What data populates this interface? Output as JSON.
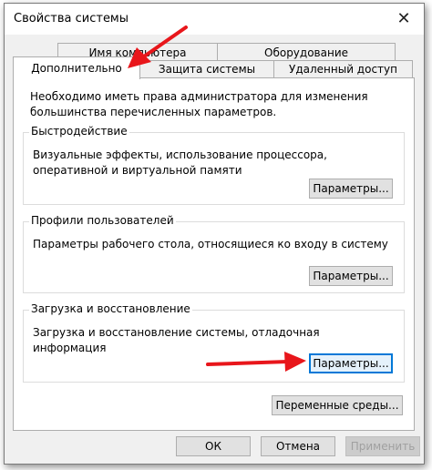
{
  "window": {
    "title": "Свойства системы",
    "close_glyph": "✕"
  },
  "tabs": {
    "computer_name": "Имя компьютера",
    "hardware": "Оборудование",
    "advanced": "Дополнительно",
    "system_protection": "Защита системы",
    "remote": "Удаленный доступ"
  },
  "panel": {
    "intro": "Необходимо иметь права администратора для изменения большинства перечисленных параметров.",
    "performance": {
      "title": "Быстродействие",
      "description": "Визуальные эффекты, использование процессора, оперативной и виртуальной памяти",
      "button": "Параметры..."
    },
    "user_profiles": {
      "title": "Профили пользователей",
      "description": "Параметры рабочего стола, относящиеся ко входу в систему",
      "button": "Параметры..."
    },
    "startup_recovery": {
      "title": "Загрузка и восстановление",
      "description": "Загрузка и восстановление системы, отладочная информация",
      "button": "Параметры..."
    },
    "env_vars_button": "Переменные среды..."
  },
  "footer": {
    "ok": "ОК",
    "cancel": "Отмена",
    "apply": "Применить"
  },
  "colors": {
    "annotation_arrow": "#e8161b",
    "focus_border": "#0078d7"
  }
}
